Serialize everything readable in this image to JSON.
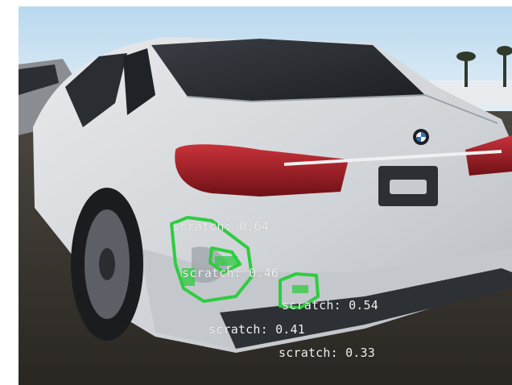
{
  "detections": [
    {
      "label": "scratch: 0.64",
      "class": "scratch",
      "confidence": 0.64
    },
    {
      "label": "scratch: 0.46",
      "class": "scratch",
      "confidence": 0.46
    },
    {
      "label": "scratch: 0.54",
      "class": "scratch",
      "confidence": 0.54
    },
    {
      "label": "scratch: 0.41",
      "class": "scratch",
      "confidence": 0.41
    },
    {
      "label": "scratch: 0.33",
      "class": "scratch",
      "confidence": 0.33
    }
  ],
  "colors": {
    "mask": "#2ecc40",
    "label_text": "#f2f2f2",
    "car_body": "#d9dbde",
    "sky": "#cfe4f2"
  },
  "icons": {
    "brand_badge": "bmw-roundel-icon"
  }
}
